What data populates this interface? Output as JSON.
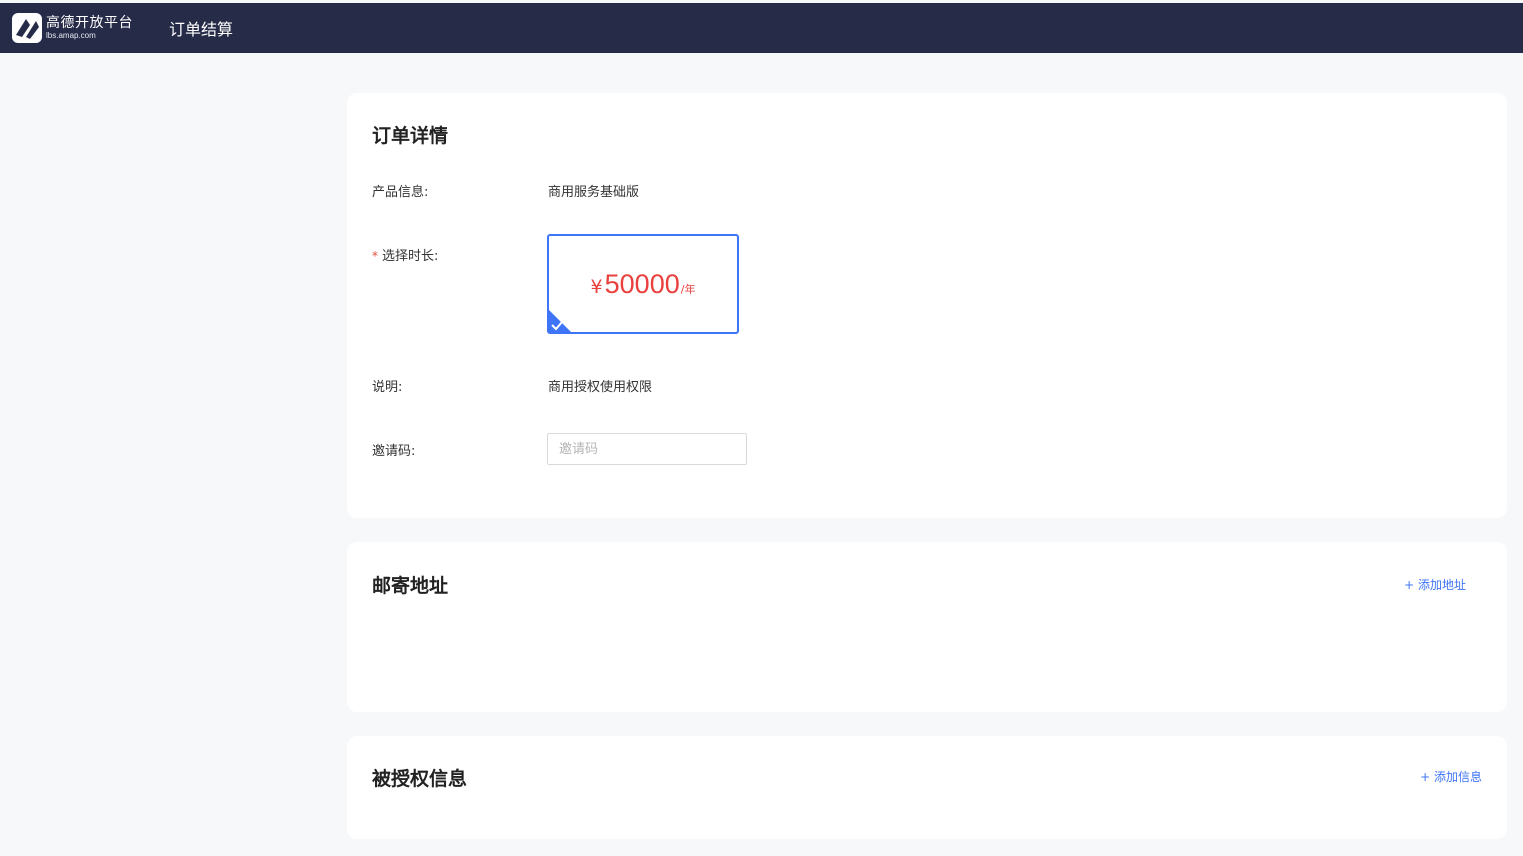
{
  "header": {
    "logo_title": "高德开放平台",
    "logo_sub": "lbs.amap.com",
    "page_title": "订单结算"
  },
  "order": {
    "title": "订单详情",
    "product_label": "产品信息:",
    "product_value": "商用服务基础版",
    "duration_required": "*",
    "duration_label": "选择时长:",
    "price_symbol": "¥",
    "price_amount": "50000",
    "price_unit": "/年",
    "desc_label": "说明:",
    "desc_value": "商用授权使用权限",
    "invite_label": "邀请码:",
    "invite_placeholder": "邀请码",
    "invite_value": ""
  },
  "address": {
    "title": "邮寄地址",
    "add_label": "+ 添加地址"
  },
  "auth": {
    "title": "被授权信息",
    "add_label": "+ 添加信息"
  },
  "colors": {
    "topbar": "#262b48",
    "accent": "#3e74f6",
    "price": "#e9403e"
  }
}
